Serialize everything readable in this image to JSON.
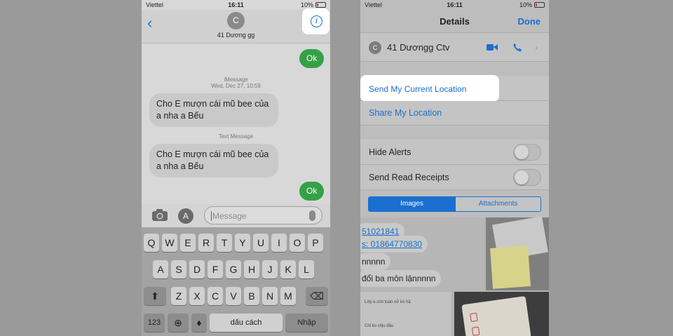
{
  "status": {
    "carrier": "Viettel",
    "time": "16:11",
    "battery": "10%"
  },
  "left": {
    "contact_initial": "C",
    "contact_name": "41 Dương gg",
    "messages": [
      {
        "text": "Ok"
      },
      {
        "service": "iMessage",
        "date": "Wed, Dec 27, 10:59"
      },
      {
        "text": "Cho E mượn cái mũ bee của a nha a Bếu"
      },
      {
        "service": "Text Message"
      },
      {
        "text": "Cho E mượn cái mũ bee của a nha a Bếu"
      },
      {
        "text": "Ok"
      }
    ],
    "input_placeholder": "Message",
    "keyboard": {
      "row1": [
        "Q",
        "W",
        "E",
        "R",
        "T",
        "Y",
        "U",
        "I",
        "O",
        "P"
      ],
      "row2": [
        "A",
        "S",
        "D",
        "F",
        "G",
        "H",
        "J",
        "K",
        "L"
      ],
      "row3": [
        "Z",
        "X",
        "C",
        "V",
        "B",
        "N",
        "M"
      ],
      "numbers": "123",
      "space": "dấu cách",
      "return": "Nhập"
    }
  },
  "right": {
    "title": "Details",
    "done": "Done",
    "contact_initial": "C",
    "contact_name": "41 Dươngg Ctv",
    "send_current_location": "Send My Current Location",
    "share_location": "Share My Location",
    "hide_alerts": "Hide Alerts",
    "read_receipts": "Send Read Receipts",
    "tabs": [
      "Images",
      "Attachments"
    ],
    "attachments": {
      "link1": "51021841",
      "link2": "s: 01864770830",
      "line3": "nnnnn",
      "line4": "đổi ba môn lậnnnnn",
      "mini1": "Lớp e còn toán nữ ko hả",
      "mini2": "Chỉ ko chịu đầu"
    }
  },
  "colors": {
    "accent": "#1a6fd0",
    "bubble_green": "#36a047"
  }
}
